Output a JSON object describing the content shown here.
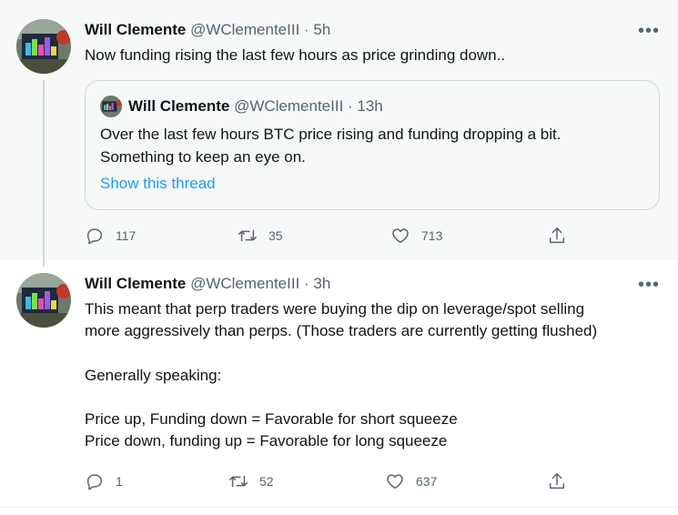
{
  "tweets": [
    {
      "author_name": "Will Clemente",
      "handle_time": "@WClementeIII · 5h",
      "text": "Now funding rising the last few hours as price grinding down..",
      "more_icon": "more-horizontal-icon",
      "quote": {
        "author_name": "Will Clemente",
        "handle_time": "@WClementeIII · 13h",
        "text": "Over the last few hours BTC price rising and funding dropping a bit.\nSomething to keep an eye on.",
        "link": "Show this thread"
      },
      "actions": {
        "replies": "117",
        "retweets": "35",
        "likes": "713"
      }
    },
    {
      "author_name": "Will Clemente",
      "handle_time": "@WClementeIII · 3h",
      "text": "This meant that perp traders were buying the dip on leverage/spot selling\nmore aggressively than perps. (Those traders are currently getting flushed)\n\nGenerally speaking:\n\nPrice up, Funding down = Favorable for short squeeze\nPrice down, funding up = Favorable for long squeeze",
      "more_icon": "more-horizontal-icon",
      "actions": {
        "replies": "1",
        "retweets": "52",
        "likes": "637"
      }
    }
  ],
  "colors": {
    "text": "#0f1419",
    "muted": "#536471",
    "link": "#1d9bf0",
    "border": "#cfd9de",
    "highlight_bg": "#f7f9f9"
  }
}
